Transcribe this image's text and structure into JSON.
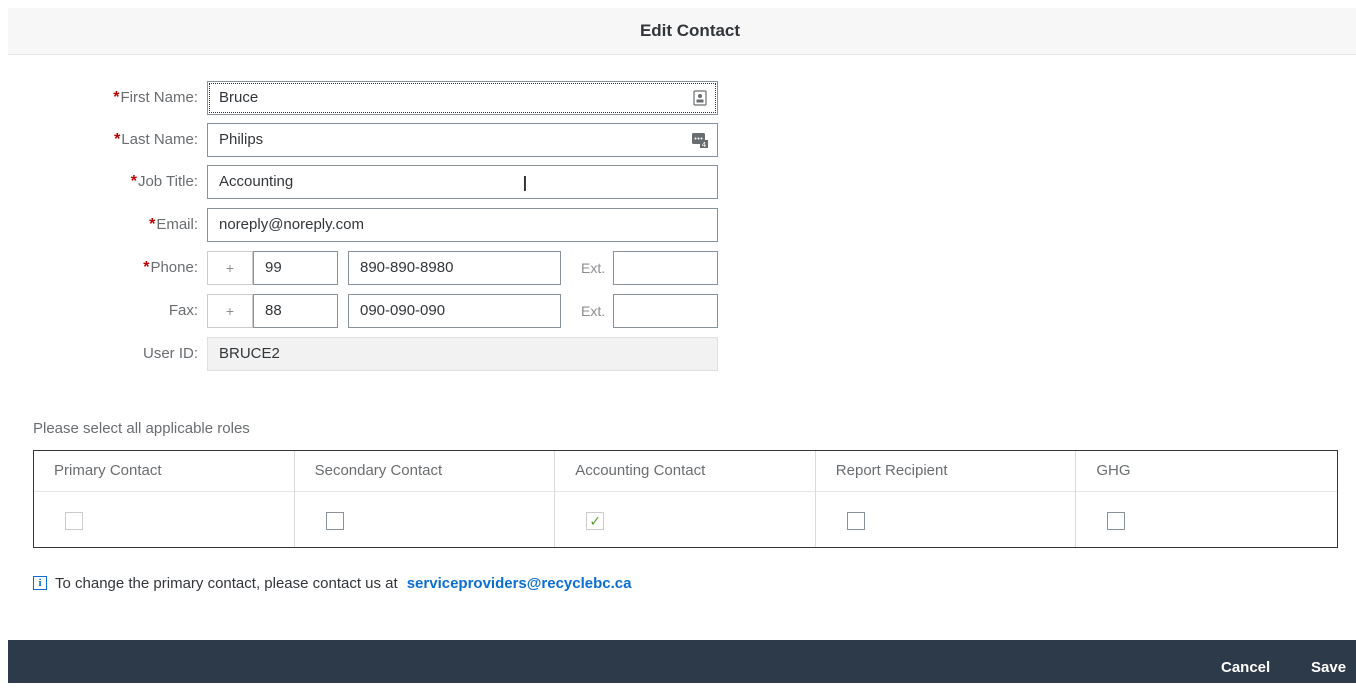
{
  "dialog": {
    "title": "Edit Contact"
  },
  "form": {
    "first_name": {
      "label": "First Name:",
      "required": "*",
      "value": "Bruce"
    },
    "last_name": {
      "label": "Last Name:",
      "required": "*",
      "value": "Philips"
    },
    "job_title": {
      "label": "Job Title:",
      "required": "*",
      "value": "Accounting"
    },
    "email": {
      "label": "Email:",
      "required": "*",
      "value": "noreply@noreply.com"
    },
    "phone": {
      "label": "Phone:",
      "required": "*",
      "plus": "+",
      "country_code": "99",
      "number": "890-890-8980",
      "ext_label": "Ext.",
      "ext_value": ""
    },
    "fax": {
      "label": "Fax:",
      "plus": "+",
      "country_code": "88",
      "number": "090-090-090",
      "ext_label": "Ext.",
      "ext_value": ""
    },
    "user_id": {
      "label": "User ID:",
      "value": "BRUCE2"
    }
  },
  "roles": {
    "prompt": "Please select all applicable roles",
    "columns": [
      {
        "label": "Primary Contact",
        "checked": false,
        "enabled": false
      },
      {
        "label": "Secondary Contact",
        "checked": false,
        "enabled": true
      },
      {
        "label": "Accounting Contact",
        "checked": true,
        "enabled": false
      },
      {
        "label": "Report Recipient",
        "checked": false,
        "enabled": true
      },
      {
        "label": "GHG",
        "checked": false,
        "enabled": true
      }
    ],
    "check_glyph": "✓"
  },
  "info": {
    "icon": "i",
    "text": "To change the primary contact, please contact us at",
    "link": "serviceproviders@recyclebc.ca"
  },
  "footer": {
    "cancel_label": "Cancel",
    "save_label": "Save"
  },
  "colors": {
    "accent": "#0a6ed1",
    "required": "#bb0000",
    "footer_bg": "#2c3a49",
    "check": "#5a9e3a"
  }
}
